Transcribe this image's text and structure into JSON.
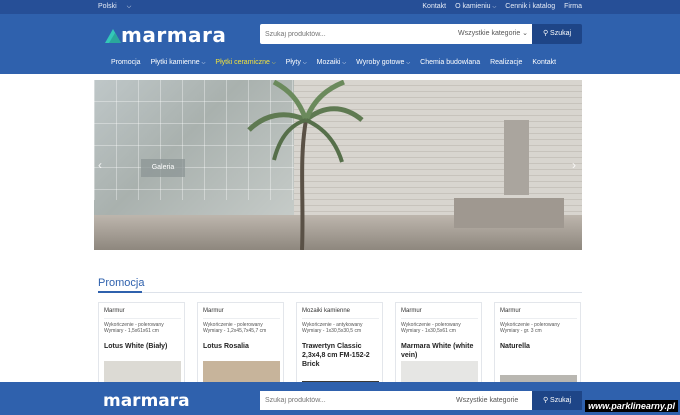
{
  "topbar": {
    "language": "Polski",
    "links": [
      "Kontakt",
      "O kamieniu",
      "Cennik i katalog",
      "Firma"
    ]
  },
  "header": {
    "logo_text": "marmara",
    "search_placeholder": "Szukaj produktów...",
    "category_select": "Wszystkie kategorie",
    "search_button": "Szukaj"
  },
  "nav": {
    "items": [
      {
        "label": "Promocja",
        "dropdown": false,
        "active": false
      },
      {
        "label": "Płytki kamienne",
        "dropdown": true,
        "active": false
      },
      {
        "label": "Płytki ceramiczne",
        "dropdown": true,
        "active": true
      },
      {
        "label": "Płyty",
        "dropdown": true,
        "active": false
      },
      {
        "label": "Mozaiki",
        "dropdown": true,
        "active": false
      },
      {
        "label": "Wyroby gotowe",
        "dropdown": true,
        "active": false
      },
      {
        "label": "Chemia budowlana",
        "dropdown": false,
        "active": false
      },
      {
        "label": "Realizacje",
        "dropdown": false,
        "active": false
      },
      {
        "label": "Kontakt",
        "dropdown": false,
        "active": false
      }
    ]
  },
  "hero": {
    "caption": "Galeria"
  },
  "promo": {
    "title": "Promocja",
    "cards": [
      {
        "kind": "Marmur",
        "spec1": "Wykończenie - polerowany",
        "spec2": "Wymiary - 1,5x61x61 cm",
        "name": "Lotus White (Biały)",
        "image_color": "#dcdad4"
      },
      {
        "kind": "Marmur",
        "spec1": "Wykończenie - polerowany",
        "spec2": "Wymiary - 1,2x45,7x45,7 cm",
        "name": "Lotus Rosalia",
        "image_color": "#c7b49b"
      },
      {
        "kind": "Mozaiki kamienne",
        "spec1": "Wykończenie - antykowany",
        "spec2": "Wymiary - 1x30,5x30,5 cm",
        "name": "Trawertyn Classic 2,3x4,8 cm FM-152-2 Brick",
        "image_color": "#3a3835"
      },
      {
        "kind": "Marmur",
        "spec1": "Wykończenie - polerowany",
        "spec2": "Wymiary - 1x30,5x61 cm",
        "name": "Marmara White (white vein)",
        "image_color": "#e6e6e4"
      },
      {
        "kind": "Marmur",
        "spec1": "Wykończenie - polerowany",
        "spec2": "Wymiary - gr. 3 cm",
        "name": "Naturella",
        "image_color": "#b9b7b1"
      }
    ]
  },
  "sticky": {
    "logo_text": "marmara",
    "search_placeholder": "Szukaj produktów...",
    "category_select": "Wszystkie kategorie",
    "search_button": "Szukaj"
  },
  "watermark": "www.parklinearny.pl",
  "colors": {
    "brand_blue": "#2f61ad",
    "topbar_blue": "#264f97",
    "button_blue": "#1e4587",
    "active_nav": "#f3e23c",
    "logo_teal": "#34c7b8"
  }
}
